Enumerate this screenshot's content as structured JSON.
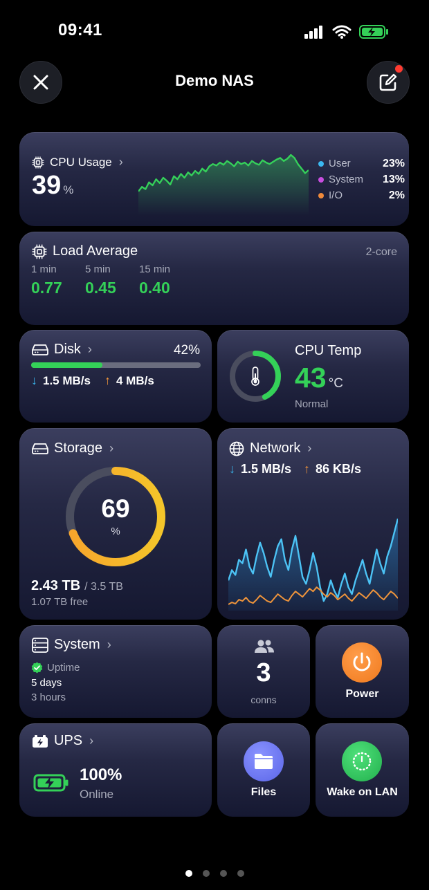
{
  "status_bar": {
    "time": "09:41"
  },
  "header": {
    "title": "Demo NAS"
  },
  "cpu_usage": {
    "title": "CPU Usage",
    "value": "39",
    "unit": "%",
    "legend": [
      {
        "label": "User",
        "value": "23%",
        "color": "#3bb8f0"
      },
      {
        "label": "System",
        "value": "13%",
        "color": "#c94ee0"
      },
      {
        "label": "I/O",
        "value": "2%",
        "color": "#f08a3b"
      }
    ],
    "history": [
      22,
      28,
      25,
      34,
      30,
      38,
      33,
      40,
      36,
      31,
      42,
      38,
      45,
      40,
      47,
      43,
      49,
      45,
      52,
      48,
      55,
      58,
      56,
      60,
      57,
      62,
      59,
      55,
      61,
      58,
      60,
      56,
      62,
      59,
      57,
      63,
      60,
      58,
      61,
      64,
      66,
      62,
      65,
      70,
      66,
      58,
      52,
      46,
      50
    ]
  },
  "load_average": {
    "title": "Load Average",
    "cores": "2-core",
    "items": [
      {
        "label": "1 min",
        "value": "0.77"
      },
      {
        "label": "5 min",
        "value": "0.45"
      },
      {
        "label": "15 min",
        "value": "0.40"
      }
    ]
  },
  "disk": {
    "title": "Disk",
    "percent_label": "42%",
    "usage_fraction": 0.42,
    "read": "1.5 MB/s",
    "write": "4 MB/s"
  },
  "cpu_temp": {
    "title": "CPU Temp",
    "value": "43",
    "unit": "°C",
    "status": "Normal",
    "gauge_fraction": 0.43
  },
  "storage": {
    "title": "Storage",
    "percent": "69",
    "percent_sign": "%",
    "fraction": 0.69,
    "used": "2.43 TB",
    "total": "/ 3.5 TB",
    "free": "1.07 TB free"
  },
  "network": {
    "title": "Network",
    "down": "1.5 MB/s",
    "up": "86 KB/s",
    "down_series": [
      40,
      55,
      48,
      70,
      65,
      85,
      60,
      50,
      75,
      95,
      80,
      60,
      45,
      70,
      90,
      100,
      70,
      55,
      85,
      105,
      75,
      45,
      35,
      55,
      80,
      60,
      30,
      10,
      20,
      40,
      25,
      15,
      35,
      50,
      30,
      20,
      40,
      55,
      70,
      50,
      35,
      60,
      85,
      65,
      50,
      75,
      90,
      110,
      130
    ],
    "up_series": [
      5,
      8,
      6,
      12,
      10,
      15,
      9,
      7,
      12,
      18,
      14,
      10,
      8,
      14,
      20,
      16,
      12,
      10,
      18,
      24,
      20,
      16,
      22,
      28,
      24,
      30,
      26,
      20,
      16,
      22,
      18,
      12,
      16,
      20,
      14,
      10,
      16,
      22,
      18,
      14,
      20,
      26,
      22,
      16,
      12,
      18,
      24,
      20,
      14
    ]
  },
  "system": {
    "title": "System",
    "uptime_label": "Uptime",
    "days": "5 days",
    "hours": "3 hours"
  },
  "connections": {
    "value": "3",
    "label": "conns"
  },
  "power": {
    "label": "Power"
  },
  "ups": {
    "title": "UPS",
    "percent": "100%",
    "status": "Online"
  },
  "files": {
    "label": "Files"
  },
  "wol": {
    "label": "Wake on LAN"
  }
}
